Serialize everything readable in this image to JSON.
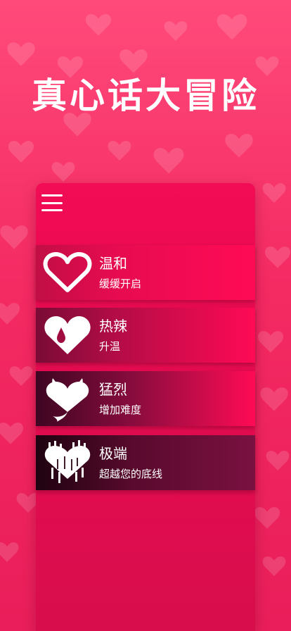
{
  "app": {
    "title": "真心话大冒险"
  },
  "menu": {
    "icon": "hamburger-menu-icon"
  },
  "levels": [
    {
      "title": "温和",
      "subtitle": "缓缓开启",
      "icon": "outline-heart-icon"
    },
    {
      "title": "热辣",
      "subtitle": "升温",
      "icon": "drop-heart-icon"
    },
    {
      "title": "猛烈",
      "subtitle": "增加难度",
      "icon": "devil-heart-icon"
    },
    {
      "title": "极端",
      "subtitle": "超越您的底线",
      "icon": "melting-heart-icon"
    }
  ],
  "colors": {
    "background": "#f42a63",
    "panel": "#f20b55",
    "text": "#ffffff"
  }
}
